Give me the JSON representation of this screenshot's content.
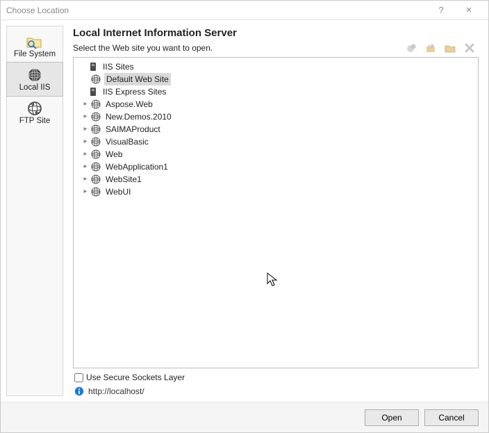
{
  "titlebar": {
    "title": "Choose Location",
    "help": "?",
    "close": "×"
  },
  "sidebar": {
    "items": [
      {
        "label": "File System",
        "selected": false
      },
      {
        "label": "Local IIS",
        "selected": true
      },
      {
        "label": "FTP Site",
        "selected": false
      }
    ]
  },
  "main": {
    "heading": "Local Internet Information Server",
    "subtitle": "Select the Web site you want to open.",
    "checkbox_label": "Use Secure Sockets Layer",
    "url_text": "http://localhost/"
  },
  "tree": {
    "roots": [
      {
        "label": "IIS Sites",
        "icon": "server",
        "children": [
          {
            "label": "Default Web Site",
            "icon": "globe",
            "selected": true
          }
        ]
      },
      {
        "label": "IIS Express Sites",
        "icon": "server",
        "children": [
          {
            "label": "Aspose.Web",
            "icon": "globe",
            "expandable": true
          },
          {
            "label": "New.Demos.2010",
            "icon": "globe",
            "expandable": true
          },
          {
            "label": "SAIMAProduct",
            "icon": "globe",
            "expandable": true
          },
          {
            "label": "VisualBasic",
            "icon": "globe",
            "expandable": true
          },
          {
            "label": "Web",
            "icon": "globe",
            "expandable": true
          },
          {
            "label": "WebApplication1",
            "icon": "globe",
            "expandable": true
          },
          {
            "label": "WebSite1",
            "icon": "globe",
            "expandable": true
          },
          {
            "label": "WebUI",
            "icon": "globe",
            "expandable": true
          }
        ]
      }
    ]
  },
  "footer": {
    "open": "Open",
    "cancel": "Cancel"
  }
}
